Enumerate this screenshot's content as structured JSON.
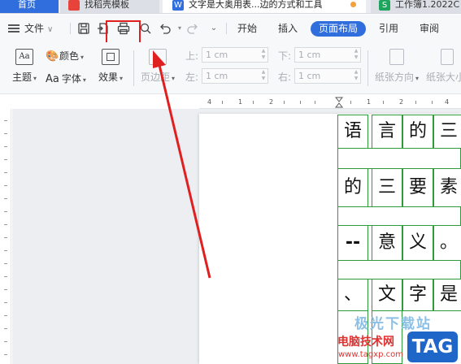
{
  "tabs": [
    {
      "label": "首页"
    },
    {
      "label": "找稻壳模板"
    },
    {
      "label": "文字是大奥用表...边的方式和工具"
    },
    {
      "label": "工作簿1.2022C"
    }
  ],
  "menu": {
    "file_label": "文件"
  },
  "ribbon_tabs": [
    {
      "label": "开始"
    },
    {
      "label": "插入"
    },
    {
      "label": "页面布局"
    },
    {
      "label": "引用"
    },
    {
      "label": "审阅"
    }
  ],
  "tools": {
    "theme_label": "主题",
    "color_label": "颜色",
    "font_label": "字体",
    "effect_label": "效果",
    "margin_btn_label": "页边距",
    "orientation_label": "纸张方向",
    "size_label": "纸张大小",
    "theme_box_text": "Aa",
    "font_prefix": "Aa"
  },
  "margins": {
    "top_label": "上:",
    "top_value": "1 cm",
    "bottom_label": "下:",
    "bottom_value": "1 cm",
    "left_label": "左:",
    "left_value": "1 cm",
    "right_label": "右:",
    "right_value": "1 cm"
  },
  "ruler": {
    "labels": [
      "4",
      "1",
      "2",
      "1",
      "2",
      "4"
    ]
  },
  "document": {
    "rows": [
      [
        "语",
        "言",
        "的",
        "三"
      ],
      [
        "的",
        "三",
        "要",
        "素"
      ],
      [
        "--",
        "意",
        "义",
        "。"
      ],
      [
        "、",
        "文",
        "字",
        "是"
      ]
    ]
  },
  "watermark": {
    "top_text": "极光下载站",
    "site_name": "电脑技术网",
    "url": "www.tagxp.com",
    "badge": "TAG"
  }
}
